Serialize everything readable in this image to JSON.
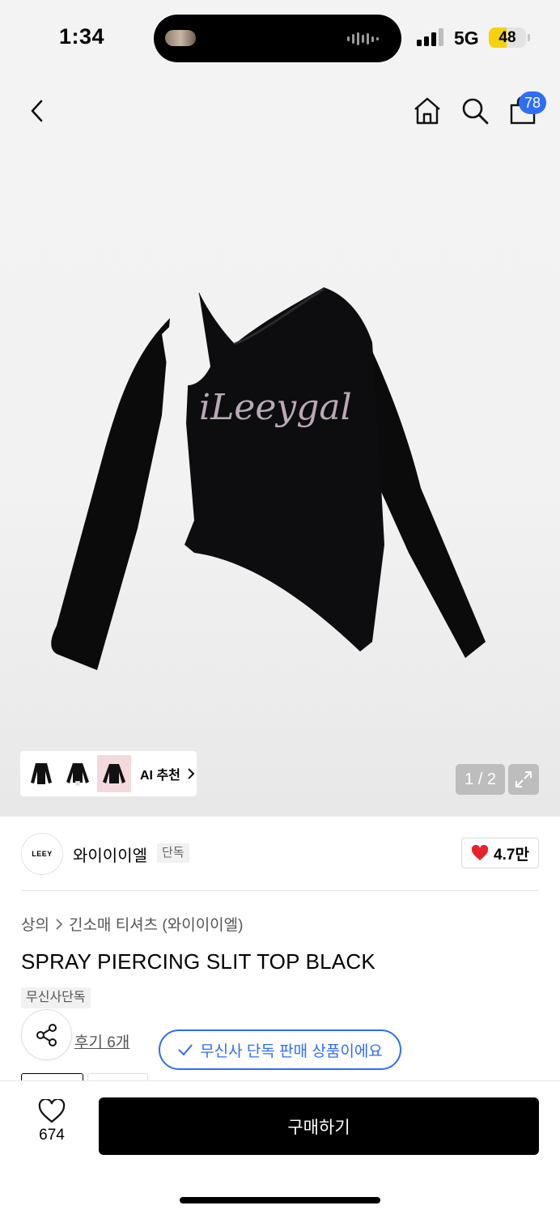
{
  "status_bar": {
    "time": "1:34",
    "network": "5G",
    "battery": "48",
    "battery_level": 0.48,
    "signal_bars": 3
  },
  "nav": {
    "icons": [
      "back-icon",
      "home-icon",
      "search-icon",
      "shopping-bag-icon"
    ],
    "cart_count": "78"
  },
  "gallery": {
    "product_text": "iLeeygal",
    "ai_label": "AI 추천",
    "page_indicator": "1 / 2"
  },
  "brand": {
    "logo_text": "LEEY",
    "name": "와이이이엘",
    "tag": "단독",
    "like_count": "4.7만"
  },
  "product": {
    "breadcrumb": [
      "상의",
      "긴소매 티셔츠 (와이이이엘)"
    ],
    "title": "SPRAY PIERCING SLIT TOP BLACK",
    "exclusive_tag": "무신사단독",
    "review_link": "후기 6개",
    "exclusive_notice": "무신사 단독 판매 상품이에요"
  },
  "bottom_bar": {
    "wish_count": "674",
    "buy_label": "구매하기"
  },
  "colors": {
    "accent_blue": "#2f6df6",
    "heart_red": "#e8222c",
    "battery_yellow": "#f5d20a"
  }
}
